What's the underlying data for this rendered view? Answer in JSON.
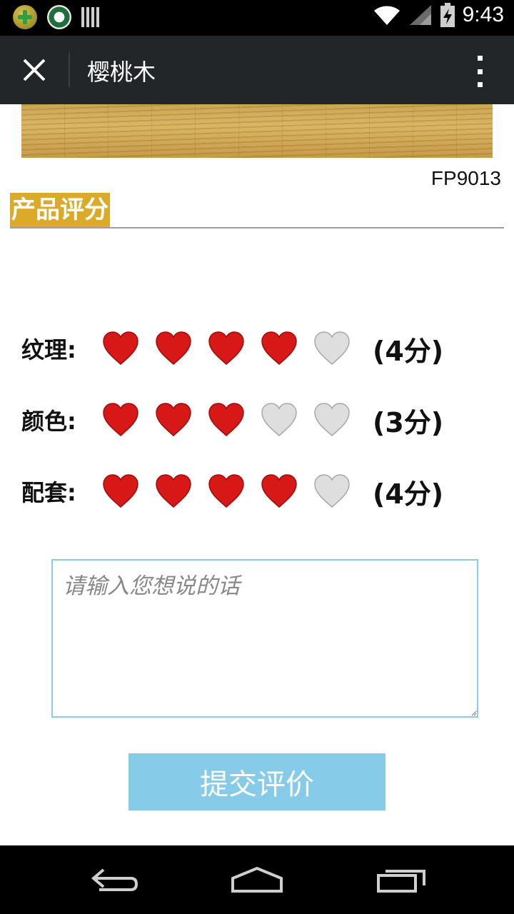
{
  "status_bar": {
    "time": "9:43",
    "icons": [
      "app-plus-icon",
      "app-logo-icon",
      "bars-icon",
      "wifi-icon",
      "signal-icon",
      "battery-charging-icon"
    ]
  },
  "header": {
    "title": "樱桃木",
    "close_icon": "close-icon",
    "menu_icon": "more-vertical-icon"
  },
  "product": {
    "code": "FP9013"
  },
  "section": {
    "title": "产品评分"
  },
  "ratings": [
    {
      "label": "纹理:",
      "value": 4,
      "max": 5,
      "score_text": "(4分)"
    },
    {
      "label": "颜色:",
      "value": 3,
      "max": 5,
      "score_text": "(3分)"
    },
    {
      "label": "配套:",
      "value": 4,
      "max": 5,
      "score_text": "(4分)"
    }
  ],
  "comment": {
    "placeholder": "请输入您想说的话",
    "value": ""
  },
  "submit": {
    "label": "提交评价"
  },
  "colors": {
    "heart_filled": "#d81717",
    "heart_empty": "#dedede",
    "section_bg": "#dcaa2a",
    "button_bg": "#86cbe8",
    "textarea_border": "#8ccbe4"
  },
  "nav_bar": {
    "icons": [
      "back-icon",
      "home-icon",
      "recent-apps-icon"
    ]
  }
}
